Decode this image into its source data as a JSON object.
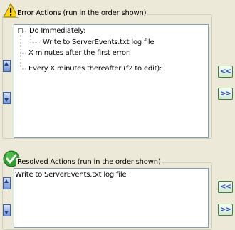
{
  "error_actions": {
    "title": "Error Actions (run in the order shown)",
    "tree": [
      {
        "label": "Do Immediately:",
        "level": 0,
        "expanded": true
      },
      {
        "label": "Write to ServerEvents.txt log file",
        "level": 1
      },
      {
        "label": "X minutes after the first error:",
        "level": 0
      },
      {
        "label": "Every X minutes thereafter (f2 to edit):",
        "level": 0
      }
    ],
    "move_left_label": "<<",
    "move_right_label": ">>"
  },
  "resolved_actions": {
    "title": "Resolved Actions (run in the order shown)",
    "items": [
      "Write to ServerEvents.txt log file"
    ],
    "move_left_label": "<<",
    "move_right_label": ">>"
  },
  "colors": {
    "dialog_bg": "#ece9d8",
    "list_border": "#7f9db9",
    "arrow_text": "#1f4fd0",
    "warning_yellow": "#ffd800",
    "ok_green": "#2e9e2e"
  }
}
